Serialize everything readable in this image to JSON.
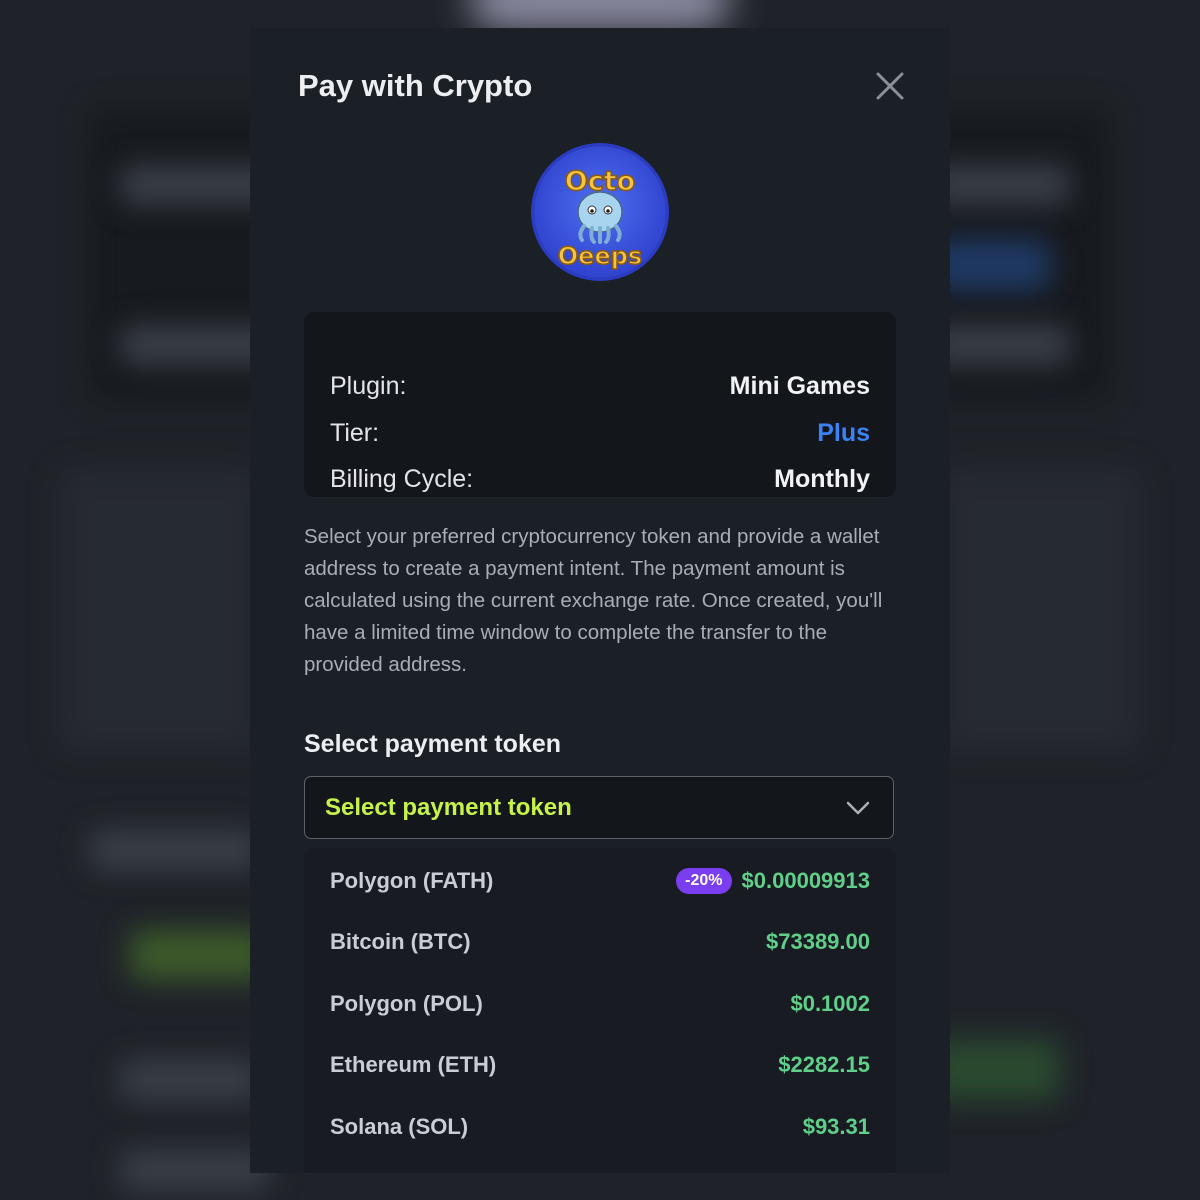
{
  "modal": {
    "title": "Pay with Crypto",
    "logo_text_top": "Octo",
    "logo_text_bottom": "Oeeps"
  },
  "summary": {
    "plugin_label": "Plugin:",
    "plugin_value": "Mini Games",
    "tier_label": "Tier:",
    "tier_value": "Plus",
    "billing_label": "Billing Cycle:",
    "billing_value": "Monthly"
  },
  "description": "Select your preferred cryptocurrency token and provide a wallet address to create a payment intent. The payment amount is calculated using the current exchange rate. Once created, you'll have a limited time window to complete the transfer to the provided address.",
  "token_select": {
    "label": "Select payment token",
    "placeholder": "Select payment token",
    "options": [
      {
        "name": "Polygon (FATH)",
        "badge": "-20%",
        "price": "$0.00009913"
      },
      {
        "name": "Bitcoin (BTC)",
        "price": "$73389.00"
      },
      {
        "name": "Polygon (POL)",
        "price": "$0.1002"
      },
      {
        "name": "Ethereum (ETH)",
        "price": "$2282.15"
      },
      {
        "name": "Solana (SOL)",
        "price": "$93.31"
      }
    ]
  },
  "colors": {
    "accent_blue": "#3b82f6",
    "placeholder_green": "#c6f24a",
    "price_green": "#5fcf8a",
    "badge_purple": "#7a3ef0"
  },
  "icons": {
    "close": "close-icon",
    "chevron": "chevron-down-icon",
    "logo": "octopus-logo-icon"
  }
}
